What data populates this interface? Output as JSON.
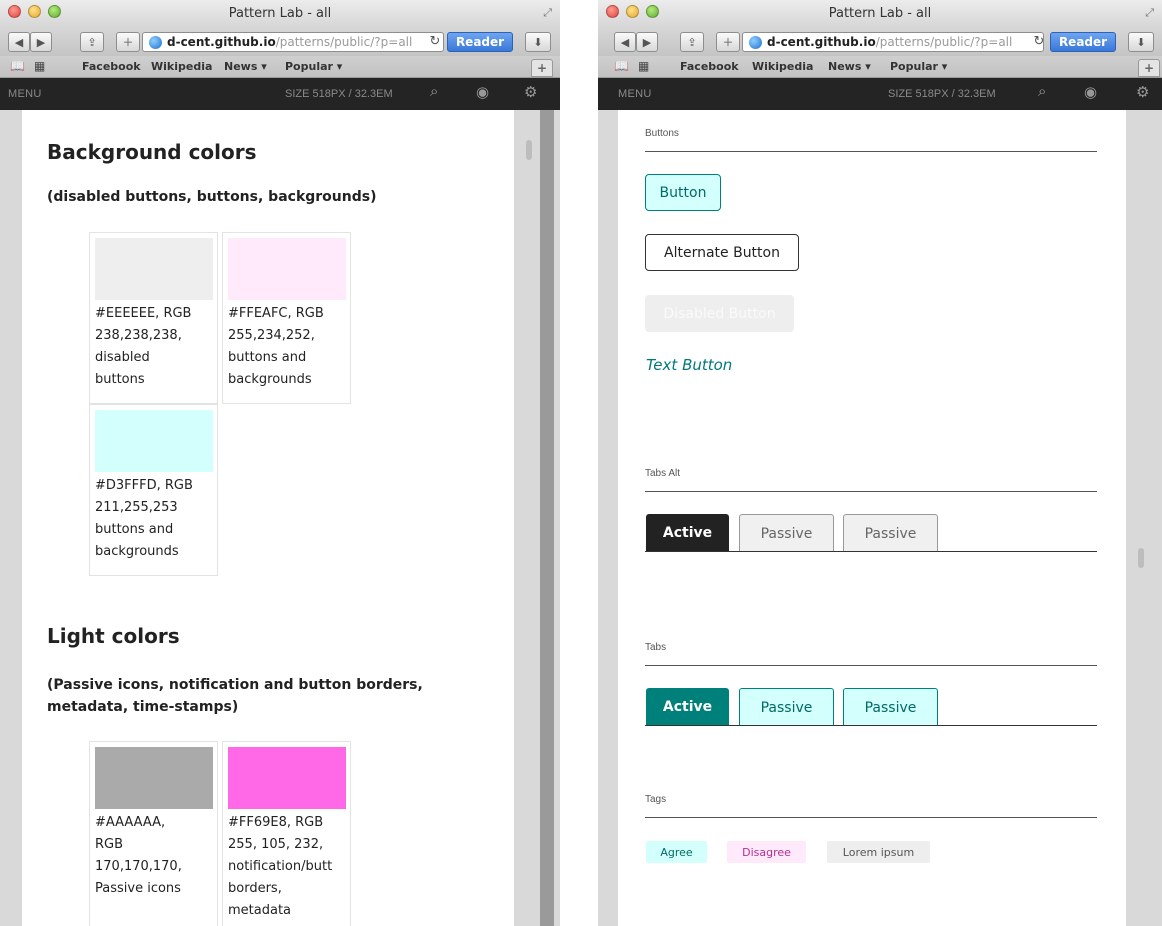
{
  "browser": {
    "title": "Pattern Lab - all",
    "address_host": "d-cent.github.io",
    "address_path": "/patterns/public/?p=all",
    "reader_label": "Reader",
    "bookmarks": [
      "Facebook",
      "Wikipedia",
      "News ▾",
      "Popular ▾"
    ]
  },
  "patternlab": {
    "menu_label": "MENU",
    "size_label": "SIZE  518PX / 32.3EM"
  },
  "left_page": {
    "background_colors": {
      "title": "Background colors",
      "subtitle": "(disabled buttons, buttons, backgrounds)",
      "swatches": [
        {
          "color": "#EEEEEE",
          "lines": [
            "#EEEEEE, RGB",
            "238,238,238,",
            "disabled",
            "buttons"
          ]
        },
        {
          "color": "#FFEAFC",
          "lines": [
            "#FFEAFC, RGB",
            "255,234,252,",
            "buttons and",
            "backgrounds"
          ]
        },
        {
          "color": "#D3FFFD",
          "lines": [
            "#D3FFFD, RGB",
            "211,255,253",
            "buttons and",
            "backgrounds"
          ]
        }
      ]
    },
    "light_colors": {
      "title": "Light colors",
      "subtitle_line1": "(Passive icons, notification and button borders,",
      "subtitle_line2": "metadata, time-stamps)",
      "swatches": [
        {
          "color": "#AAAAAA",
          "lines": [
            "#AAAAAA,",
            "RGB",
            "170,170,170,",
            "Passive icons"
          ]
        },
        {
          "color": "#FF69E8",
          "lines": [
            "#FF69E8, RGB",
            "255, 105, 232,",
            "notification/butt",
            "borders,",
            "metadata"
          ]
        }
      ]
    }
  },
  "right_page": {
    "buttons": {
      "label": "Buttons",
      "primary": "Button",
      "alternate": "Alternate Button",
      "disabled": "Disabled Button",
      "text": "Text Button"
    },
    "tabs_alt": {
      "label": "Tabs Alt",
      "items": [
        "Active",
        "Passive",
        "Passive"
      ]
    },
    "tabs": {
      "label": "Tabs",
      "items": [
        "Active",
        "Passive",
        "Passive"
      ]
    },
    "tags": {
      "label": "Tags",
      "items": [
        "Agree",
        "Disagree",
        "Lorem ipsum"
      ]
    }
  }
}
